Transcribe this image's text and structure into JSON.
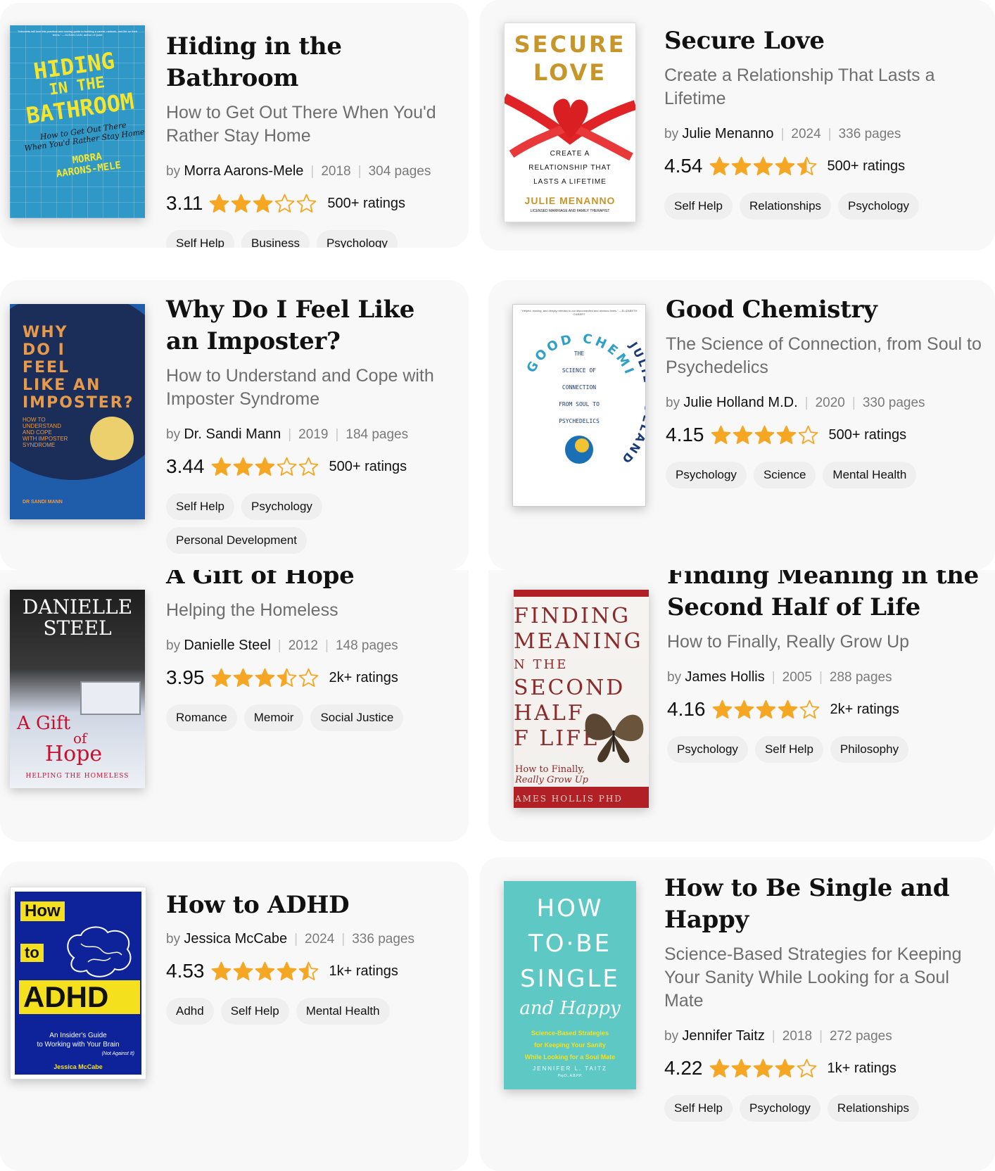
{
  "books": [
    {
      "title": "Hiding in the Bathroom",
      "subtitle": "How to Get Out There When You'd Rather Stay Home",
      "by": "by",
      "author": "Morra Aarons-Mele",
      "year": "2018",
      "pages": "304 pages",
      "rating": "3.11",
      "stars": 3,
      "ratings_count": "500+ ratings",
      "tags": [
        "Self Help",
        "Business",
        "Psychology"
      ],
      "cover": {
        "top_blurb": "\"Introverts will love this practical and moving guide to building a career, network, and life on their terms.\" —SUSAN CAIN, author of Quiet",
        "line1": "HIDING",
        "line2": "IN THE",
        "line3": "BATHROOM",
        "sub1": "How to Get Out There",
        "sub2": "When You'd Rather Stay Home",
        "author1": "MORRA",
        "author2": "AARONS-MELE"
      }
    },
    {
      "title": "Secure Love",
      "subtitle": "Create a Relationship That Lasts a Lifetime",
      "by": "by",
      "author": "Julie Menanno",
      "year": "2024",
      "pages": "336 pages",
      "rating": "4.54",
      "stars": 4.5,
      "ratings_count": "500+ ratings",
      "tags": [
        "Self Help",
        "Relationships",
        "Psychology"
      ],
      "cover": {
        "line1": "SECURE",
        "line2": "LOVE",
        "sub1": "CREATE A",
        "sub2": "RELATIONSHIP THAT",
        "sub3": "LASTS A LIFETIME",
        "author": "JULIE MENANNO",
        "credential": "LICENSED MARRIAGE AND FAMILY THERAPIST"
      }
    },
    {
      "title": "Why Do I Feel Like an Imposter?",
      "subtitle": "How to Understand and Cope with Imposter Syndrome",
      "by": "by",
      "author": "Dr. Sandi Mann",
      "year": "2019",
      "pages": "184 pages",
      "rating": "3.44",
      "stars": 3,
      "ratings_count": "500+ ratings",
      "tags": [
        "Self Help",
        "Psychology",
        "Personal Development"
      ],
      "cover": {
        "line1": "WHY",
        "line2": "DO I",
        "line3": "FEEL",
        "line4": "LIKE AN",
        "line5": "IMPOSTER?",
        "sub1": "HOW TO",
        "sub2": "UNDERSTAND",
        "sub3": "AND COPE",
        "sub4": "WITH IMPOSTER",
        "sub5": "SYNDROME",
        "author": "DR SANDI MANN"
      }
    },
    {
      "title": "Good Chemistry",
      "subtitle": "The Science of Connection, from Soul to Psychedelics",
      "by": "by",
      "author": "Julie Holland M.D.",
      "year": "2020",
      "pages": "330 pages",
      "rating": "4.15",
      "stars": 4,
      "ratings_count": "500+ ratings",
      "tags": [
        "Psychology",
        "Science",
        "Mental Health"
      ],
      "cover": {
        "top_blurb": "\"Helpful, moving, and deeply relevant to our disconnected and anxious times.\" —ELIZABETH GILBERT",
        "arc": "GOOD CHEMISTRY",
        "sub1": "THE",
        "sub2": "SCIENCE OF",
        "sub3": "CONNECTION",
        "sub4": "FROM SOUL TO",
        "sub5": "PSYCHEDELICS",
        "author_arc": "JULIE HOLLAND, MD"
      }
    },
    {
      "title": "A Gift of Hope",
      "subtitle": "Helping the Homeless",
      "by": "by",
      "author": "Danielle Steel",
      "year": "2012",
      "pages": "148 pages",
      "rating": "3.95",
      "stars": 3.5,
      "ratings_count": "2k+ ratings",
      "tags": [
        "Romance",
        "Memoir",
        "Social Justice"
      ],
      "cover": {
        "author1": "DANIELLE",
        "author2": "STEEL",
        "t1": "A Gift",
        "t2": "of",
        "t3": "Hope",
        "sub": "HELPING THE HOMELESS"
      }
    },
    {
      "title": "Finding Meaning in the Second Half of Life",
      "subtitle": "How to Finally, Really Grow Up",
      "by": "by",
      "author": "James Hollis",
      "year": "2005",
      "pages": "288 pages",
      "rating": "4.16",
      "stars": 4,
      "ratings_count": "2k+ ratings",
      "tags": [
        "Psychology",
        "Self Help",
        "Philosophy"
      ],
      "cover": {
        "l1": "FINDING",
        "l2": "MEANING",
        "l3": "N THE",
        "l4": "SECOND",
        "l5": "HALF",
        "l6": "F LIFE",
        "sub1": "How to Finally,",
        "sub2": "Really Grow Up",
        "author": "AMES HOLLIS PHD"
      }
    },
    {
      "title": "How to ADHD",
      "subtitle": "",
      "by": "by",
      "author": "Jessica McCabe",
      "year": "2024",
      "pages": "336 pages",
      "rating": "4.53",
      "stars": 4.5,
      "ratings_count": "1k+ ratings",
      "tags": [
        "Adhd",
        "Self Help",
        "Mental Health"
      ],
      "cover": {
        "w1": "How",
        "w2": "to",
        "w3": "ADHD",
        "sub1": "An Insider's Guide",
        "sub2": "to Working with Your Brain",
        "sub3": "(Not Against It)",
        "author": "Jessica McCabe"
      }
    },
    {
      "title": "How to Be Single and Happy",
      "subtitle": "Science-Based Strategies for Keeping Your Sanity While Looking for a Soul Mate",
      "by": "by",
      "author": "Jennifer Taitz",
      "year": "2018",
      "pages": "272 pages",
      "rating": "4.22",
      "stars": 4,
      "ratings_count": "1k+ ratings",
      "tags": [
        "Self Help",
        "Psychology",
        "Relationships"
      ],
      "cover": {
        "l1": "HOW",
        "l2": "TO·BE",
        "l3": "SINGLE",
        "l4": "and Happy",
        "sub1": "Science-Based Strategies",
        "sub2": "for Keeping Your Sanity",
        "sub3": "While Looking for a Soul Mate",
        "author": "JENNIFER L. TAITZ",
        "credential": "Psy.D., A.B.P.P."
      }
    }
  ],
  "colors": {
    "star": "#f5a623",
    "card_bg": "#f8f8f8",
    "tag_bg": "#efefef"
  }
}
